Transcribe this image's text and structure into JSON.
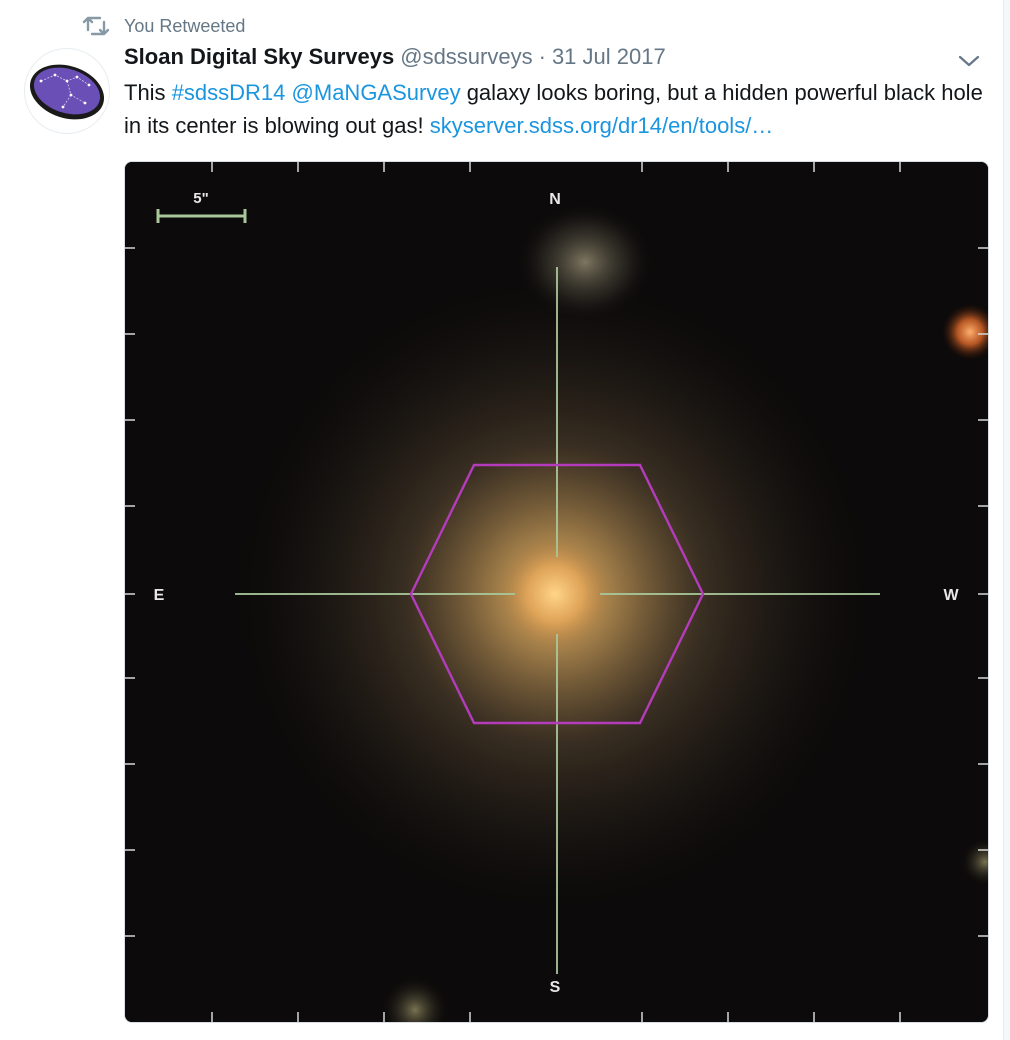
{
  "context": {
    "label": "You Retweeted",
    "icon": "retweet-icon"
  },
  "author": {
    "name": "Sloan Digital Sky Surveys",
    "handle": "@sdssurveys",
    "separator": "·",
    "date": "31 Jul 2017",
    "avatar_icon": "constellation-logo-icon"
  },
  "tweet": {
    "text_before": "This ",
    "hashtag": "#sdssDR14",
    "space": " ",
    "mention": "@MaNGASurvey",
    "text_middle": " galaxy looks boring, but a hidden powerful black hole in its center is blowing out gas! ",
    "link": "skyserver.sdss.org/dr14/en/tools/…"
  },
  "image": {
    "scale_label": "5\"",
    "north": "N",
    "south": "S",
    "east": "E",
    "west": "W",
    "hexagon_color": "#b43cbc",
    "crosshair_color": "#a9c79a"
  },
  "colors": {
    "link": "#1b95e0",
    "secondary_text": "#657786",
    "primary_text": "#14171a"
  }
}
